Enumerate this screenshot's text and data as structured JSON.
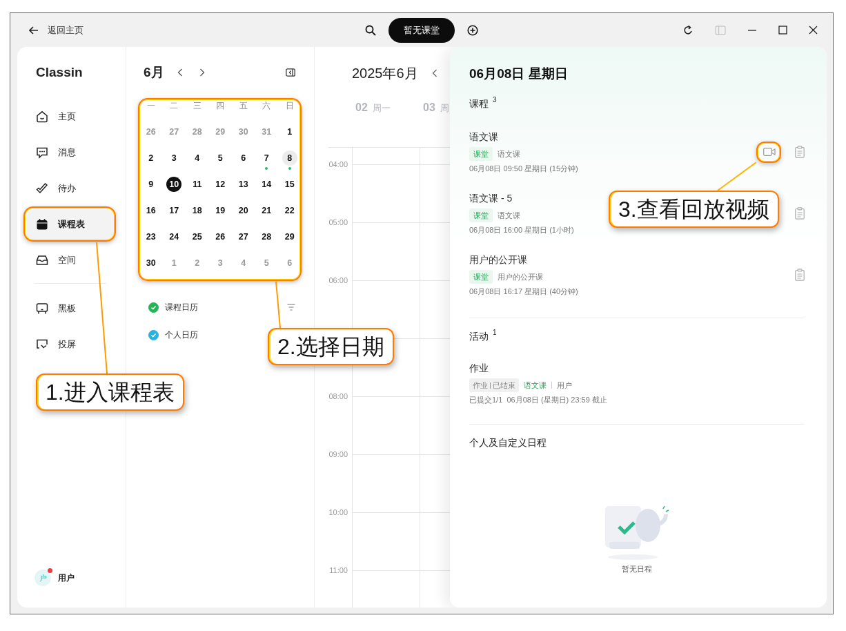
{
  "top_bar": {
    "back": "返回主页",
    "classroom_button": "暂无课堂"
  },
  "sidebar": {
    "logo": "Classin",
    "items": [
      {
        "label": "主页",
        "selected": false
      },
      {
        "label": "消息",
        "selected": false
      },
      {
        "label": "待办",
        "selected": false
      },
      {
        "label": "课程表",
        "selected": true
      },
      {
        "label": "空间",
        "selected": false
      }
    ],
    "tools": [
      {
        "label": "黑板",
        "selected": false
      },
      {
        "label": "投屏",
        "selected": false
      }
    ],
    "user": {
      "avatar": "户",
      "name": "用户",
      "notification": true
    }
  },
  "mini_calendar": {
    "month": "6月",
    "weekdays": [
      "一",
      "二",
      "三",
      "四",
      "五",
      "六",
      "日"
    ],
    "days": [
      {
        "d": "26",
        "muted": true,
        "today": false,
        "selected": false,
        "event": false
      },
      {
        "d": "27",
        "muted": true,
        "today": false,
        "selected": false,
        "event": false
      },
      {
        "d": "28",
        "muted": true,
        "today": false,
        "selected": false,
        "event": false
      },
      {
        "d": "29",
        "muted": true,
        "today": false,
        "selected": false,
        "event": false
      },
      {
        "d": "30",
        "muted": true,
        "today": false,
        "selected": false,
        "event": false
      },
      {
        "d": "31",
        "muted": true,
        "today": false,
        "selected": false,
        "event": false
      },
      {
        "d": "1",
        "muted": false,
        "today": false,
        "selected": false,
        "event": false
      },
      {
        "d": "2",
        "muted": false,
        "today": false,
        "selected": false,
        "event": false
      },
      {
        "d": "3",
        "muted": false,
        "today": false,
        "selected": false,
        "event": false
      },
      {
        "d": "4",
        "muted": false,
        "today": false,
        "selected": false,
        "event": false
      },
      {
        "d": "5",
        "muted": false,
        "today": false,
        "selected": false,
        "event": false
      },
      {
        "d": "6",
        "muted": false,
        "today": false,
        "selected": false,
        "event": false
      },
      {
        "d": "7",
        "muted": false,
        "today": false,
        "selected": false,
        "event": true
      },
      {
        "d": "8",
        "muted": false,
        "today": false,
        "selected": true,
        "event": true
      },
      {
        "d": "9",
        "muted": false,
        "today": false,
        "selected": false,
        "event": false
      },
      {
        "d": "10",
        "muted": false,
        "today": true,
        "selected": false,
        "event": false
      },
      {
        "d": "11",
        "muted": false,
        "today": false,
        "selected": false,
        "event": false
      },
      {
        "d": "12",
        "muted": false,
        "today": false,
        "selected": false,
        "event": false
      },
      {
        "d": "13",
        "muted": false,
        "today": false,
        "selected": false,
        "event": false
      },
      {
        "d": "14",
        "muted": false,
        "today": false,
        "selected": false,
        "event": false
      },
      {
        "d": "15",
        "muted": false,
        "today": false,
        "selected": false,
        "event": false
      },
      {
        "d": "16",
        "muted": false,
        "today": false,
        "selected": false,
        "event": false
      },
      {
        "d": "17",
        "muted": false,
        "today": false,
        "selected": false,
        "event": false
      },
      {
        "d": "18",
        "muted": false,
        "today": false,
        "selected": false,
        "event": false
      },
      {
        "d": "19",
        "muted": false,
        "today": false,
        "selected": false,
        "event": false
      },
      {
        "d": "20",
        "muted": false,
        "today": false,
        "selected": false,
        "event": false
      },
      {
        "d": "21",
        "muted": false,
        "today": false,
        "selected": false,
        "event": false
      },
      {
        "d": "22",
        "muted": false,
        "today": false,
        "selected": false,
        "event": false
      },
      {
        "d": "23",
        "muted": false,
        "today": false,
        "selected": false,
        "event": false
      },
      {
        "d": "24",
        "muted": false,
        "today": false,
        "selected": false,
        "event": false
      },
      {
        "d": "25",
        "muted": false,
        "today": false,
        "selected": false,
        "event": false
      },
      {
        "d": "26",
        "muted": false,
        "today": false,
        "selected": false,
        "event": false
      },
      {
        "d": "27",
        "muted": false,
        "today": false,
        "selected": false,
        "event": false
      },
      {
        "d": "28",
        "muted": false,
        "today": false,
        "selected": false,
        "event": false
      },
      {
        "d": "29",
        "muted": false,
        "today": false,
        "selected": false,
        "event": false
      },
      {
        "d": "30",
        "muted": false,
        "today": false,
        "selected": false,
        "event": false
      },
      {
        "d": "1",
        "muted": true,
        "today": false,
        "selected": false,
        "event": false
      },
      {
        "d": "2",
        "muted": true,
        "today": false,
        "selected": false,
        "event": false
      },
      {
        "d": "3",
        "muted": true,
        "today": false,
        "selected": false,
        "event": false
      },
      {
        "d": "4",
        "muted": true,
        "today": false,
        "selected": false,
        "event": false
      },
      {
        "d": "5",
        "muted": true,
        "today": false,
        "selected": false,
        "event": false
      },
      {
        "d": "6",
        "muted": true,
        "today": false,
        "selected": false,
        "event": false
      }
    ],
    "calendars": [
      {
        "label": "课程日历",
        "checked": true,
        "color": "#22b455"
      },
      {
        "label": "个人日历",
        "checked": true,
        "color": "#27b3dd"
      }
    ]
  },
  "week_view": {
    "title": "2025年6月",
    "days": [
      {
        "num": "02",
        "label": "周一"
      },
      {
        "num": "03",
        "label": "周"
      }
    ],
    "hours": [
      "04:00",
      "05:00",
      "06:00",
      "08:00",
      "09:00",
      "10:00",
      "11:00"
    ]
  },
  "detail": {
    "title": "06月08日 星期日",
    "courses_heading": "课程",
    "courses_count": "3",
    "courses": [
      {
        "title": "语文课",
        "tag": "课堂",
        "subject": "语文课",
        "time": "06月08日 09:50 星期日 (15分钟)",
        "replay": true
      },
      {
        "title": "语文课 - 5",
        "tag": "课堂",
        "subject": "语文课",
        "time": "06月08日 16:00 星期日 (1小时)",
        "replay": false
      },
      {
        "title": "用户的公开课",
        "tag": "课堂",
        "subject": "用户的公开课",
        "time": "06月08日 16:17 星期日 (40分钟)",
        "replay": false
      }
    ],
    "activities_heading": "活动",
    "activities_count": "1",
    "activities": [
      {
        "title": "作业",
        "type": "作业",
        "status": "已结束",
        "course": "语文课",
        "owner": "用户",
        "line": "已提交1/1  06月08日 (星期日) 23:59 截止"
      }
    ],
    "personal_heading": "个人及自定义日程",
    "empty": "暂无日程"
  },
  "annotations": [
    {
      "label": "1.进入课程表"
    },
    {
      "label": "2.选择日期"
    },
    {
      "label": "3.查看回放视频"
    }
  ]
}
